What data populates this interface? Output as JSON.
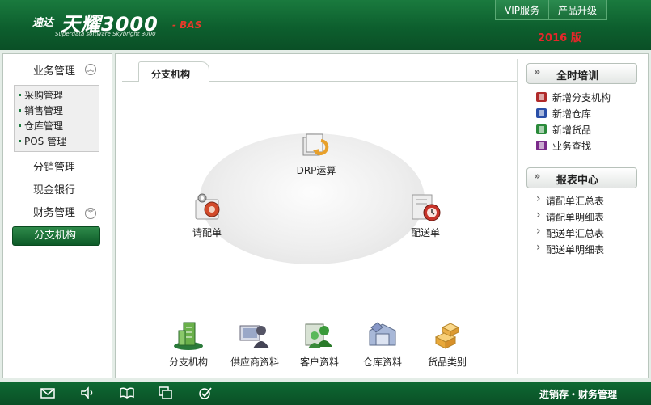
{
  "header": {
    "logo_prefix": "速达",
    "logo_main": "天耀3000",
    "logo_suffix": "- BAS",
    "logo_subtitle": "Superdata software Skybright 3000",
    "links": [
      "VIP服务",
      "产品升级"
    ],
    "version": "2016 版"
  },
  "sidebar": {
    "group1": {
      "label": "业务管理",
      "items": [
        "采购管理",
        "销售管理",
        "仓库管理",
        "POS 管理"
      ]
    },
    "items": [
      "分销管理",
      "现金银行"
    ],
    "group2": {
      "label": "财务管理"
    },
    "active": "分支机构"
  },
  "main": {
    "tab": "分支机构",
    "flow": {
      "top": "DRP运算",
      "left": "请配单",
      "right": "配送单"
    },
    "shortcuts": [
      "分支机构",
      "供应商资料",
      "客户资料",
      "仓库资料",
      "货品类别"
    ]
  },
  "right": {
    "training": {
      "title": "全时培训",
      "items": [
        {
          "label": "新增分支机构",
          "color": "#b02a2a"
        },
        {
          "label": "新增仓库",
          "color": "#2a4fa8"
        },
        {
          "label": "新增货品",
          "color": "#2a8a3a"
        },
        {
          "label": "业务查找",
          "color": "#7a2a8a"
        }
      ]
    },
    "reports": {
      "title": "报表中心",
      "items": [
        "请配单汇总表",
        "请配单明细表",
        "配送单汇总表",
        "配送单明细表"
      ]
    }
  },
  "footer": {
    "icons": [
      "mail-icon",
      "speaker-icon",
      "book-icon",
      "windows-icon",
      "check-icon"
    ],
    "title": "进销存・财务管理"
  },
  "colors": {
    "brand_green": "#0d5f2e",
    "accent_red": "#e6262a"
  }
}
